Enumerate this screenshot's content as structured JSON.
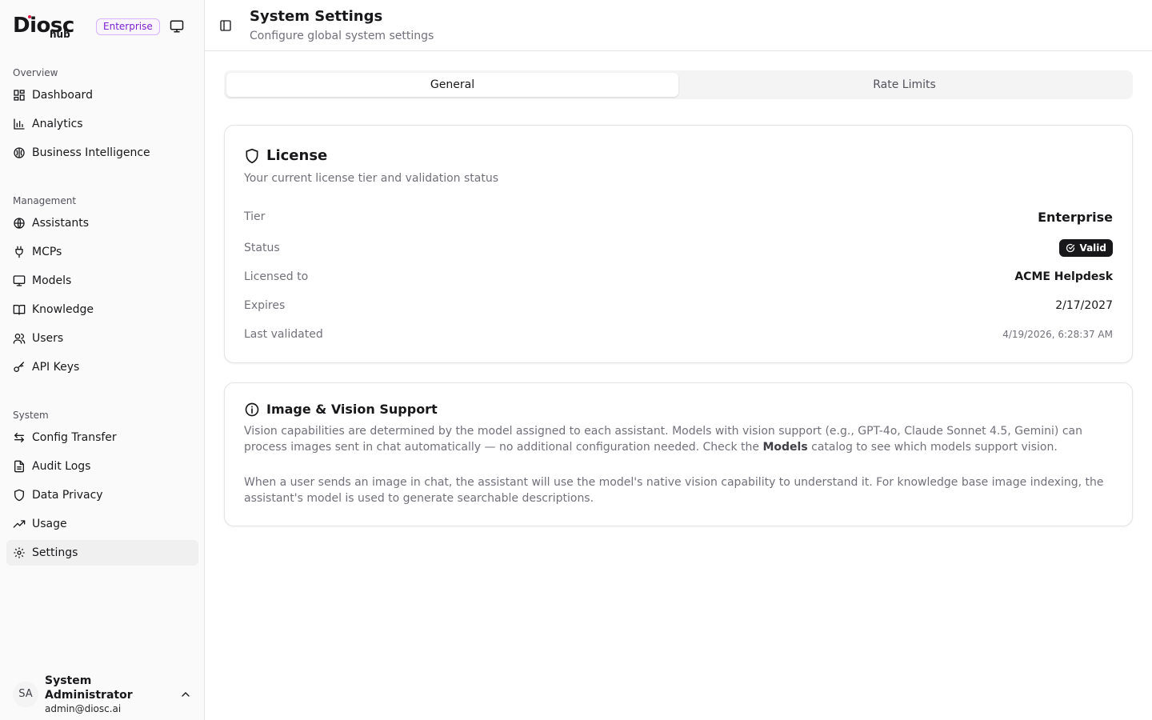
{
  "brand": {
    "logo_main": "Diosc",
    "logo_sub": "hub",
    "tier_badge": "Enterprise"
  },
  "sidebar": {
    "sections": [
      {
        "label": "Overview",
        "items": [
          "Dashboard",
          "Analytics",
          "Business Intelligence"
        ]
      },
      {
        "label": "Management",
        "items": [
          "Assistants",
          "MCPs",
          "Models",
          "Knowledge",
          "Users",
          "API Keys"
        ]
      },
      {
        "label": "System",
        "items": [
          "Config Transfer",
          "Audit Logs",
          "Data Privacy",
          "Usage",
          "Settings"
        ]
      }
    ],
    "active_item": "Settings"
  },
  "user": {
    "initials": "SA",
    "name": "System Administrator",
    "email": "admin@diosc.ai"
  },
  "header": {
    "title": "System Settings",
    "subtitle": "Configure global system settings"
  },
  "tabs": [
    {
      "label": "General",
      "active": true
    },
    {
      "label": "Rate Limits",
      "active": false
    }
  ],
  "license": {
    "title": "License",
    "description": "Your current license tier and validation status",
    "rows": [
      {
        "label": "Tier",
        "value": "Enterprise"
      },
      {
        "label": "Status",
        "value": "Valid"
      },
      {
        "label": "Licensed to",
        "value": "ACME Helpdesk"
      },
      {
        "label": "Expires",
        "value": "2/17/2027"
      },
      {
        "label": "Last validated",
        "value": "4/19/2026, 6:28:37 AM"
      }
    ]
  },
  "vision": {
    "title": "Image & Vision Support",
    "p1_before": "Vision capabilities are determined by the model assigned to each assistant. Models with vision support (e.g., GPT-4o, Claude Sonnet 4.5, Gemini) can process images sent in chat automatically — no additional configuration needed. Check the ",
    "p1_bold": "Models",
    "p1_after": " catalog to see which models support vision.",
    "p2": "When a user sends an image in chat, the assistant will use the model's native vision capability to understand it. For knowledge base image indexing, the assistant's model is used to generate searchable descriptions."
  },
  "colors": {
    "accent_purple": "#7e22ce",
    "badge_dark": "#18181b",
    "muted_text": "#71717a"
  },
  "icons": {
    "nav": [
      "dashboard-icon",
      "chart-icon",
      "brain-icon",
      "globe-icon",
      "plug-icon",
      "monitor-icon",
      "book-icon",
      "users-icon",
      "key-icon",
      "transfer-icon",
      "file-icon",
      "shield-icon",
      "trend-icon",
      "gear-icon"
    ]
  }
}
